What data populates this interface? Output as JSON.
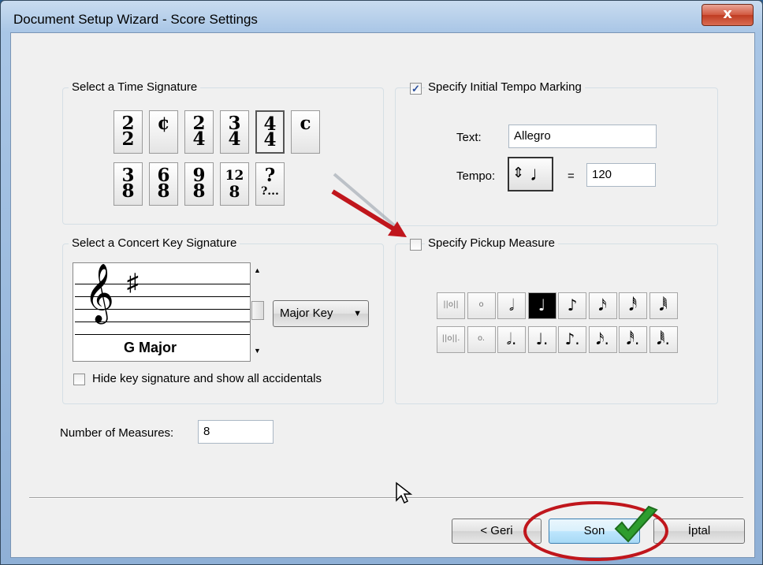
{
  "window": {
    "title": "Document Setup Wizard - Score Settings",
    "close_glyph": "x"
  },
  "time_signature": {
    "label": "Select a Time Signature",
    "row1": [
      {
        "top": "2",
        "bottom": "2"
      },
      {
        "top": "¢",
        "bottom": ""
      },
      {
        "top": "2",
        "bottom": "4"
      },
      {
        "top": "3",
        "bottom": "4"
      },
      {
        "top": "4",
        "bottom": "4"
      },
      {
        "top": "c",
        "bottom": ""
      }
    ],
    "row2": [
      {
        "top": "3",
        "bottom": "8"
      },
      {
        "top": "6",
        "bottom": "8"
      },
      {
        "top": "9",
        "bottom": "8"
      },
      {
        "top": "12",
        "bottom": "8"
      },
      {
        "top": "?",
        "bottom": "?..."
      }
    ],
    "selected": "4/4"
  },
  "tempo": {
    "checkbox_label": "Specify Initial Tempo Marking",
    "checked": true,
    "text_label": "Text:",
    "text_value": "Allegro",
    "tempo_label": "Tempo:",
    "equals": "=",
    "tempo_value": "120",
    "note_glyph": "♩",
    "spinner_glyph": "⇕"
  },
  "key_signature": {
    "label": "Select a Concert Key Signature",
    "clef": "𝄞",
    "sharp": "♯",
    "key_name": "G Major",
    "mode": "Major Key",
    "hide_label": "Hide key signature and show all accidentals",
    "hide_checked": false
  },
  "pickup": {
    "checkbox_label": "Specify Pickup Measure",
    "checked": false,
    "row1": [
      "||o||",
      "o",
      "𝅗𝅥",
      "♩",
      "♪",
      "𝅘𝅥𝅯",
      "𝅘𝅥𝅰",
      "𝅘𝅥𝅱"
    ],
    "row2": [
      "||o||.",
      "o.",
      "𝅗𝅥.",
      "♩.",
      "♪.",
      "𝅘𝅥𝅯.",
      "𝅘𝅥𝅰.",
      "𝅘𝅥𝅱."
    ],
    "selected": "♩"
  },
  "measures": {
    "label": "Number of Measures:",
    "value": "8"
  },
  "buttons": {
    "back": "< Geri",
    "finish": "Son",
    "cancel": "İptal"
  },
  "colors": {
    "annotation_red": "#c0161c",
    "checkmark_green": "#2e9d2e"
  }
}
